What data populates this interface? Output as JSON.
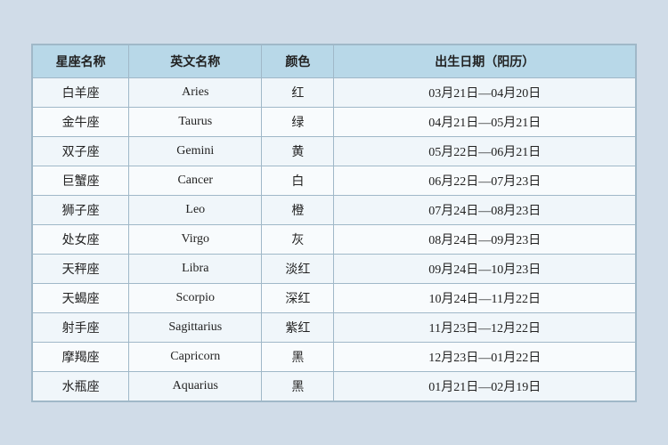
{
  "table": {
    "headers": [
      {
        "key": "chinese",
        "label": "星座名称"
      },
      {
        "key": "english",
        "label": "英文名称"
      },
      {
        "key": "color",
        "label": "颜色"
      },
      {
        "key": "date",
        "label": "出生日期（阳历）"
      }
    ],
    "rows": [
      {
        "chinese": "白羊座",
        "english": "Aries",
        "color": "红",
        "date": "03月21日—04月20日"
      },
      {
        "chinese": "金牛座",
        "english": "Taurus",
        "color": "绿",
        "date": "04月21日—05月21日"
      },
      {
        "chinese": "双子座",
        "english": "Gemini",
        "color": "黄",
        "date": "05月22日—06月21日"
      },
      {
        "chinese": "巨蟹座",
        "english": "Cancer",
        "color": "白",
        "date": "06月22日—07月23日"
      },
      {
        "chinese": "狮子座",
        "english": "Leo",
        "color": "橙",
        "date": "07月24日—08月23日"
      },
      {
        "chinese": "处女座",
        "english": "Virgo",
        "color": "灰",
        "date": "08月24日—09月23日"
      },
      {
        "chinese": "天秤座",
        "english": "Libra",
        "color": "淡红",
        "date": "09月24日—10月23日"
      },
      {
        "chinese": "天蝎座",
        "english": "Scorpio",
        "color": "深红",
        "date": "10月24日—11月22日"
      },
      {
        "chinese": "射手座",
        "english": "Sagittarius",
        "color": "紫红",
        "date": "11月23日—12月22日"
      },
      {
        "chinese": "摩羯座",
        "english": "Capricorn",
        "color": "黑",
        "date": "12月23日—01月22日"
      },
      {
        "chinese": "水瓶座",
        "english": "Aquarius",
        "color": "黑",
        "date": "01月21日—02月19日"
      }
    ]
  }
}
